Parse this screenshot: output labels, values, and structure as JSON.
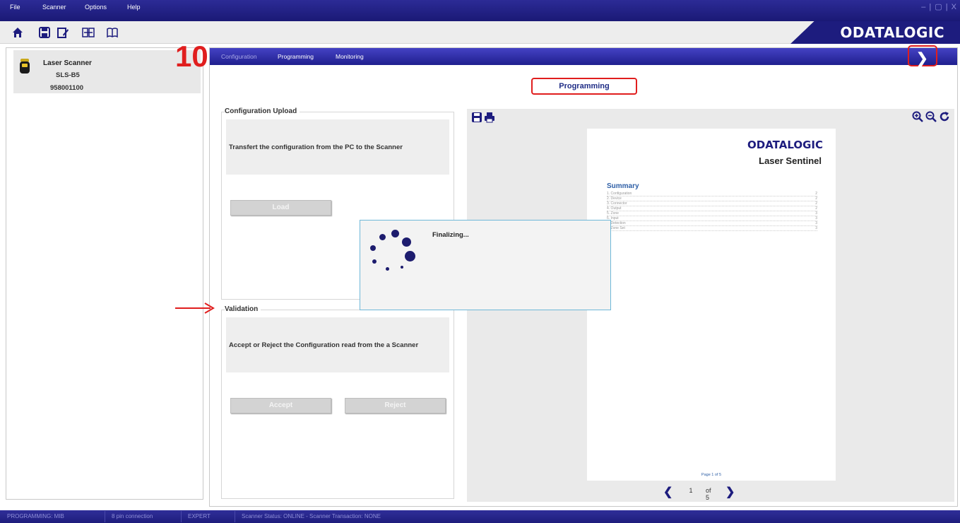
{
  "menubar": {
    "items": [
      "File",
      "Scanner",
      "Options",
      "Help"
    ],
    "window_controls": "– | ▢ | X"
  },
  "toolbar": {
    "icons": [
      "home-icon",
      "save-icon",
      "edit-icon",
      "compare-icon",
      "manual-icon"
    ],
    "logo": "ODATALOGIC"
  },
  "sidebar": {
    "device_name": "Laser Scanner",
    "device_model": "SLS-B5",
    "device_serial": "958001100"
  },
  "annotation": {
    "step_number": "10"
  },
  "nav": {
    "tabs": [
      {
        "label": "Configuration",
        "active": false
      },
      {
        "label": "Programming",
        "active": true
      },
      {
        "label": "Monitoring",
        "active": true
      }
    ],
    "next_icon": "chevron-right-icon"
  },
  "page": {
    "heading": "Programming"
  },
  "upload": {
    "title": "Configuration Upload",
    "description": "Transfert the configuration from the PC to the Scanner",
    "load_label": "Load"
  },
  "validation": {
    "title": "Validation",
    "description": "Accept or Reject the Configuration read from the a Scanner",
    "accept_label": "Accept",
    "reject_label": "Reject"
  },
  "preview": {
    "logo": "ODATALOGIC",
    "product": "Laser Sentinel",
    "summary_title": "Summary",
    "toc": [
      {
        "label": "1. Configuration",
        "page": "2"
      },
      {
        "label": "2. Device",
        "page": "2"
      },
      {
        "label": "3. Connector",
        "page": "2"
      },
      {
        "label": "4. Output",
        "page": "2"
      },
      {
        "label": "5. Zone",
        "page": "3"
      },
      {
        "label": "6. Input",
        "page": "3"
      },
      {
        "label": "7. Detection",
        "page": "3"
      },
      {
        "label": "8. Zone Set",
        "page": "3"
      }
    ],
    "footer": "Page 1 of 5",
    "current_page": "1",
    "of_label": "of 5"
  },
  "dialog": {
    "message": "Finalizing..."
  },
  "status": {
    "mode": "PROGRAMMING: MIB",
    "connection": "8 pin connection",
    "level": "EXPERT",
    "scanner_status": "Scanner Status: ONLINE - Scanner Transaction: NONE"
  },
  "colors": {
    "brand": "#1d1c7e",
    "accent_red": "#e01e1e",
    "link_blue": "#2e5fa6"
  }
}
